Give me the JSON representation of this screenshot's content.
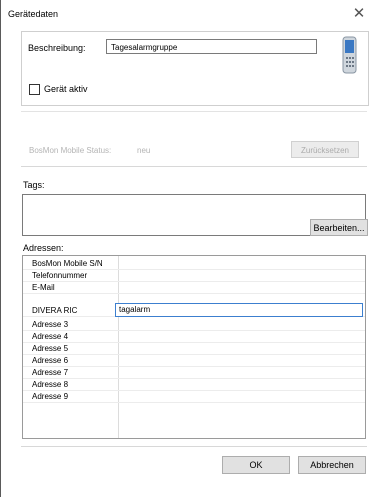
{
  "window": {
    "title": "Gerätedaten"
  },
  "general": {
    "description_label": "Beschreibung:",
    "description_value": "Tagesalarmgruppe",
    "active_label": "Gerät aktiv",
    "active_checked": false
  },
  "status": {
    "label": "BosMon Mobile Status:",
    "value": "neu",
    "reset_button": "Zurücksetzen"
  },
  "tags": {
    "label": "Tags:",
    "edit_button": "Bearbeiten..."
  },
  "addresses": {
    "label": "Adressen:",
    "rows": [
      {
        "name": "BosMon Mobile S/N",
        "value": ""
      },
      {
        "name": "Telefonnummer",
        "value": ""
      },
      {
        "name": "E-Mail",
        "value": ""
      },
      {
        "name": "DIVERA RIC",
        "value": "tagalarm"
      },
      {
        "name": "Adresse 3",
        "value": ""
      },
      {
        "name": "Adresse 4",
        "value": ""
      },
      {
        "name": "Adresse 5",
        "value": ""
      },
      {
        "name": "Adresse 6",
        "value": ""
      },
      {
        "name": "Adresse 7",
        "value": ""
      },
      {
        "name": "Adresse 8",
        "value": ""
      },
      {
        "name": "Adresse 9",
        "value": ""
      }
    ]
  },
  "footer": {
    "ok_button": "OK",
    "cancel_button": "Abbrechen"
  }
}
